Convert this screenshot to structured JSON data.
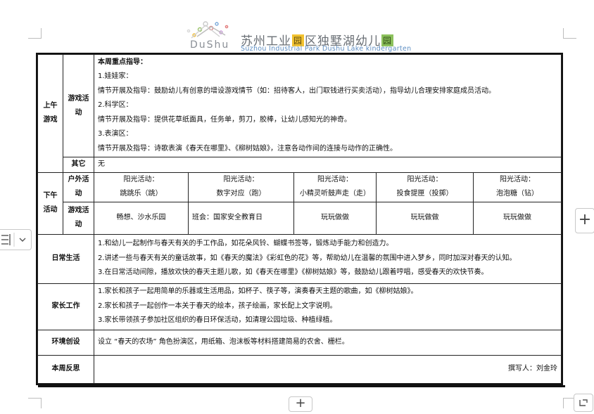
{
  "header": {
    "logo_text": "DuShu",
    "school_cn_1": "苏州工业",
    "school_cn_yuan": "园",
    "school_cn_2": "区独墅湖幼儿",
    "school_cn_er": "园",
    "school_en": "Suzhou Industrial Park Dushu Lake kindergarten"
  },
  "morning": {
    "label": "上午游戏",
    "game_label": "游戏活动",
    "title": "本周重点指导：",
    "p1": "1.娃娃家：",
    "p2": "情节开展及指导：鼓励幼儿有创意的增设游戏情节（如：招待客人，出门取钱进行买卖活动），指导幼儿合理安排家庭成员活动。",
    "p3": "2.科学区：",
    "p4": "情节开展及指导：提供花草纸面具，任务单，剪刀，胶棒，让幼儿感知光的神奇。",
    "p5": "3.表演区：",
    "p6": "情节开展及指导：诗歌表演《春天在哪里》、《柳树姑娘》，注意各动作间的连接与动作的正确性。",
    "other_label": "其它",
    "other_value": "无"
  },
  "afternoon": {
    "label": "下午活动",
    "outdoor_label": "户外活动",
    "outdoor": [
      {
        "l1": "阳光活动：",
        "l2": "跳跳乐（跳）"
      },
      {
        "l1": "阳光活动：",
        "l2": "数字对应（跑）"
      },
      {
        "l1": "阳光活动：",
        "l2": "小精灵听鼓声走（走）"
      },
      {
        "l1": "阳光活动：",
        "l2": "投食提匣（投掷）"
      },
      {
        "l1": "阳光活动：",
        "l2": "泡泡糖（钻）"
      }
    ],
    "game_label": "游戏活动",
    "games": [
      "畅想、沙水乐园",
      "班会：国家安全教育日",
      "玩玩做做",
      "玩玩做做",
      "玩玩做做"
    ]
  },
  "daily": {
    "label": "日常生活",
    "p1": "1.和幼儿一起制作与春天有关的手工作品，如花朵风铃、蝴蝶书签等，锻炼动手能力和创造力。",
    "p2": "2.讲述一些与春天有关的童话故事，如《春天的魔法》《彩虹色的花》等，帮助幼儿在温馨的氛围中进入梦乡，同时加深对春天的认知。",
    "p3": "3.在日常活动间隙，播放欢快的春天主题儿歌，如《春天在哪里》《柳树姑娘》等，鼓励幼儿跟着哼唱，感受春天的欢快节奏。"
  },
  "parents": {
    "label": "家长工作",
    "p1": "1.家长和孩子一起用简单的乐器或生活用品，如杯子、筷子等，演奏春天主题的歌曲，如《柳树姑娘》。",
    "p2": "2.家长和孩子一起创作一本关于春天的绘本，孩子绘画，家长配上文字说明。",
    "p3": "3.家长带领孩子参加社区组织的春日环保活动，如清理公园垃圾、种植绿植。"
  },
  "env": {
    "label": "环境创设",
    "text": "设立 “春天的农场” 角色扮演区，用纸箱、泡沫板等材料搭建简易的农舍、栅栏。"
  },
  "reflect": {
    "label": "本周反思",
    "author": "撰写人：刘金玲"
  },
  "ui": {
    "plus": "+"
  }
}
